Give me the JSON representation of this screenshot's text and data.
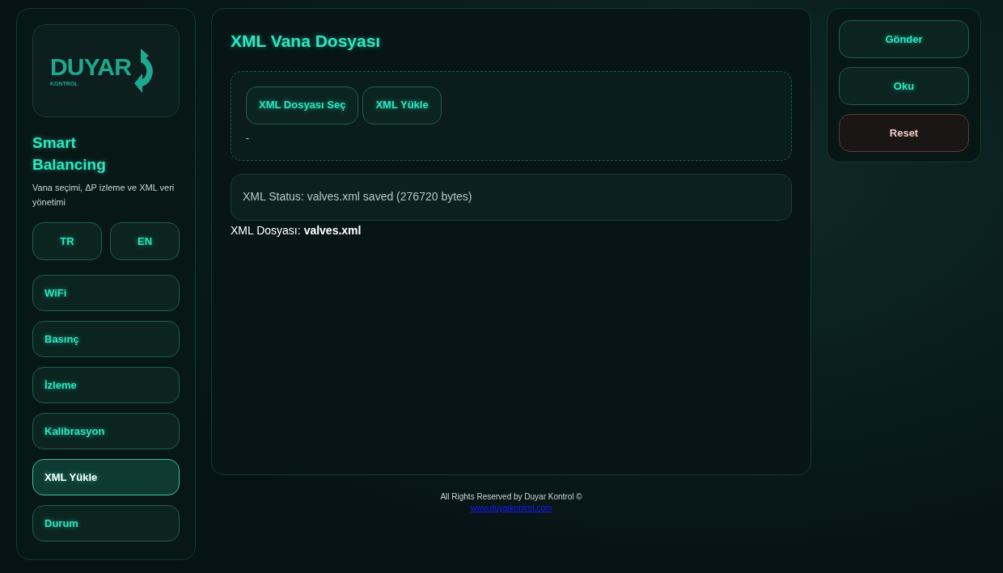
{
  "sidebar": {
    "logo": {
      "name": "DUYAR",
      "sub": "KONTROL"
    },
    "title": "Smart Balancing",
    "subtitle": "Vana seçimi, ΔP izleme ve XML veri yönetimi",
    "languages": [
      {
        "label": "TR",
        "selected": false
      },
      {
        "label": "EN",
        "selected": false
      }
    ],
    "items": [
      {
        "label": "WiFi",
        "selected": false
      },
      {
        "label": "Basınç",
        "selected": false
      },
      {
        "label": "İzleme",
        "selected": false
      },
      {
        "label": "Kalibrasyon",
        "selected": false
      },
      {
        "label": "XML Yükle",
        "selected": true
      },
      {
        "label": "Durum",
        "selected": false
      }
    ]
  },
  "main": {
    "title": "XML Vana Dosyası",
    "buttons": [
      "XML Dosyası Seç",
      "XML Yükle"
    ],
    "selection": "-",
    "status": "XML Status: valves.xml saved (276720 bytes)",
    "file_label": "XML Dosyası:",
    "file_name": "valves.xml"
  },
  "actions": [
    {
      "label": "Gönder",
      "kind": "primary"
    },
    {
      "label": "Oku",
      "kind": "primary"
    },
    {
      "label": "Reset",
      "kind": "danger"
    }
  ],
  "footer": {
    "text": "All Rights Reserved by Duyar Kontrol ©",
    "link": "www.duyarkontrol.com"
  }
}
